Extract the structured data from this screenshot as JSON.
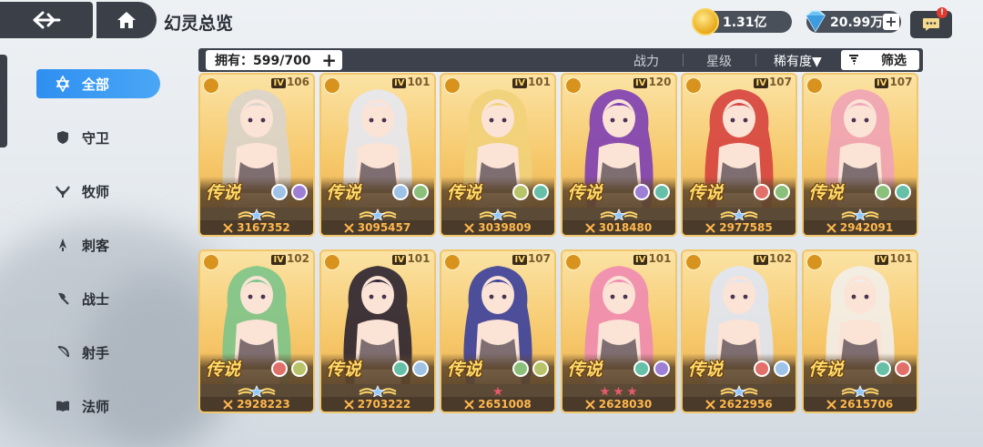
{
  "header": {
    "page_title": "幻灵总览",
    "gold": "1.31亿",
    "gems": "20.99万",
    "gems_plus": "+",
    "notify": "!"
  },
  "sidebar": {
    "items": [
      {
        "label": "全部",
        "icon": "star-of-david-icon",
        "active": true
      },
      {
        "label": "守卫",
        "icon": "shield-icon",
        "active": false
      },
      {
        "label": "牧师",
        "icon": "wings-icon",
        "active": false
      },
      {
        "label": "刺客",
        "icon": "dagger-icon",
        "active": false
      },
      {
        "label": "战士",
        "icon": "axe-icon",
        "active": false
      },
      {
        "label": "射手",
        "icon": "bow-icon",
        "active": false
      },
      {
        "label": "法师",
        "icon": "book-icon",
        "active": false
      }
    ]
  },
  "filterbar": {
    "owned_label": "拥有：599/700",
    "owned_plus": "+",
    "sort_power": "战力",
    "sort_star": "星级",
    "sort_rarity": "稀有度▼",
    "filter_label": "筛选"
  },
  "cards": [
    {
      "level": "106",
      "rarity": "传说",
      "power": "3167352",
      "stars": 0,
      "hair": "#d9d4cc",
      "elements": [
        "#9fc3e6",
        "#9d7fd6"
      ],
      "class_icon": "shield-icon"
    },
    {
      "level": "101",
      "rarity": "传说",
      "power": "3095457",
      "stars": 0,
      "hair": "#e6e8f2",
      "elements": [
        "#9fc3e6",
        "#8bc07a"
      ],
      "class_icon": "book-icon"
    },
    {
      "level": "101",
      "rarity": "传说",
      "power": "3039809",
      "stars": 0,
      "hair": "#f1d27a",
      "elements": [
        "#b9c46a",
        "#66c0a8"
      ],
      "class_icon": "wings-icon"
    },
    {
      "level": "120",
      "rarity": "传说",
      "power": "3018480",
      "stars": 0,
      "hair": "#7d3fb4",
      "elements": [
        "#9d7fd6",
        "#66c0a8"
      ],
      "class_icon": "bow-icon"
    },
    {
      "level": "107",
      "rarity": "传说",
      "power": "2977585",
      "stars": 0,
      "hair": "#d6433f",
      "elements": [
        "#e2706a",
        "#8bc07a"
      ],
      "class_icon": "axe-icon"
    },
    {
      "level": "107",
      "rarity": "传说",
      "power": "2942091",
      "stars": 0,
      "hair": "#f0a3b6",
      "elements": [
        "#8bc07a",
        "#66c0a8"
      ],
      "class_icon": "axe-icon"
    },
    {
      "level": "102",
      "rarity": "传说",
      "power": "2928223",
      "stars": 0,
      "hair": "#7cc48a",
      "elements": [
        "#e2706a",
        "#b9c46a"
      ],
      "class_icon": "wings-icon"
    },
    {
      "level": "101",
      "rarity": "传说",
      "power": "2703222",
      "stars": 0,
      "hair": "#2a2230",
      "elements": [
        "#66c0a8",
        "#9fc3e6"
      ],
      "class_icon": "book-icon"
    },
    {
      "level": "107",
      "rarity": "传说",
      "power": "2651008",
      "stars": 1,
      "hair": "#3a3f9c",
      "elements": [
        "#8bc07a",
        "#b9c46a"
      ],
      "class_icon": "axe-icon"
    },
    {
      "level": "101",
      "rarity": "传说",
      "power": "2628030",
      "stars": 3,
      "hair": "#f08bb1",
      "elements": [
        "#66c0a8",
        "#9d7fd6"
      ],
      "class_icon": "book-icon"
    },
    {
      "level": "102",
      "rarity": "传说",
      "power": "2622956",
      "stars": 0,
      "hair": "#dfe6f4",
      "elements": [
        "#e2706a",
        "#9fc3e6"
      ],
      "class_icon": "dagger-icon"
    },
    {
      "level": "101",
      "rarity": "传说",
      "power": "2615706",
      "stars": 0,
      "hair": "#f2eeea",
      "elements": [
        "#66c0a8",
        "#e2706a"
      ],
      "class_icon": "axe-icon"
    }
  ],
  "level_prefix": "IV",
  "colors": {
    "accent": "#3599f2",
    "dark_panel": "#3a3f48",
    "card_gold": "#f6c769",
    "power_text": "#ffb84d"
  }
}
